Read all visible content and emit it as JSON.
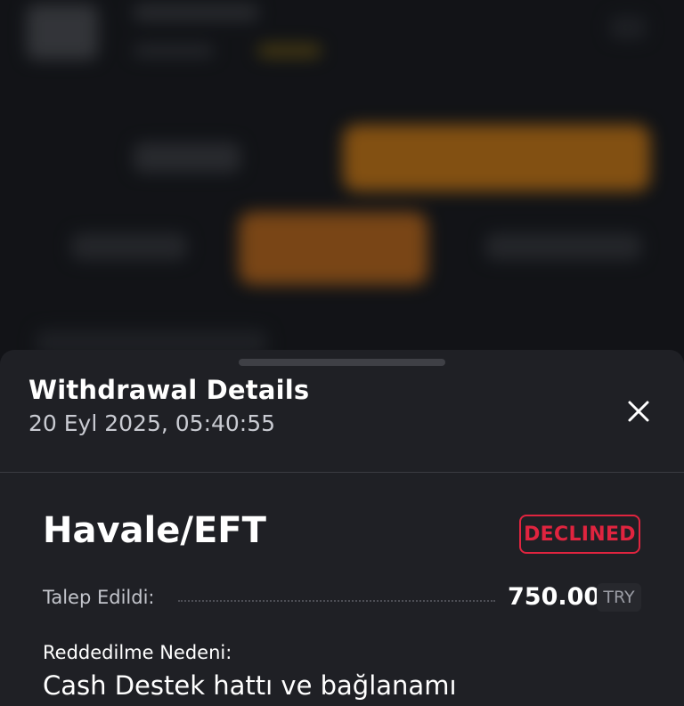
{
  "sheet": {
    "title": "Withdrawal Details",
    "datetime": "20 Eyl 2025, 05:40:55",
    "close_icon": "close-icon"
  },
  "withdrawal": {
    "method": "Havale/EFT",
    "status": "DECLINED",
    "requested_label": "Talep Edildi:",
    "amount": "750.00",
    "currency": "TRY",
    "reason_label": "Reddedilme Nedeni:",
    "reason_text": "Cash Destek hattı ve bağlanamı"
  },
  "colors": {
    "status_declined": "#e0243f",
    "sheet_bg": "#1f2025",
    "accent_orange": "#c47515"
  }
}
